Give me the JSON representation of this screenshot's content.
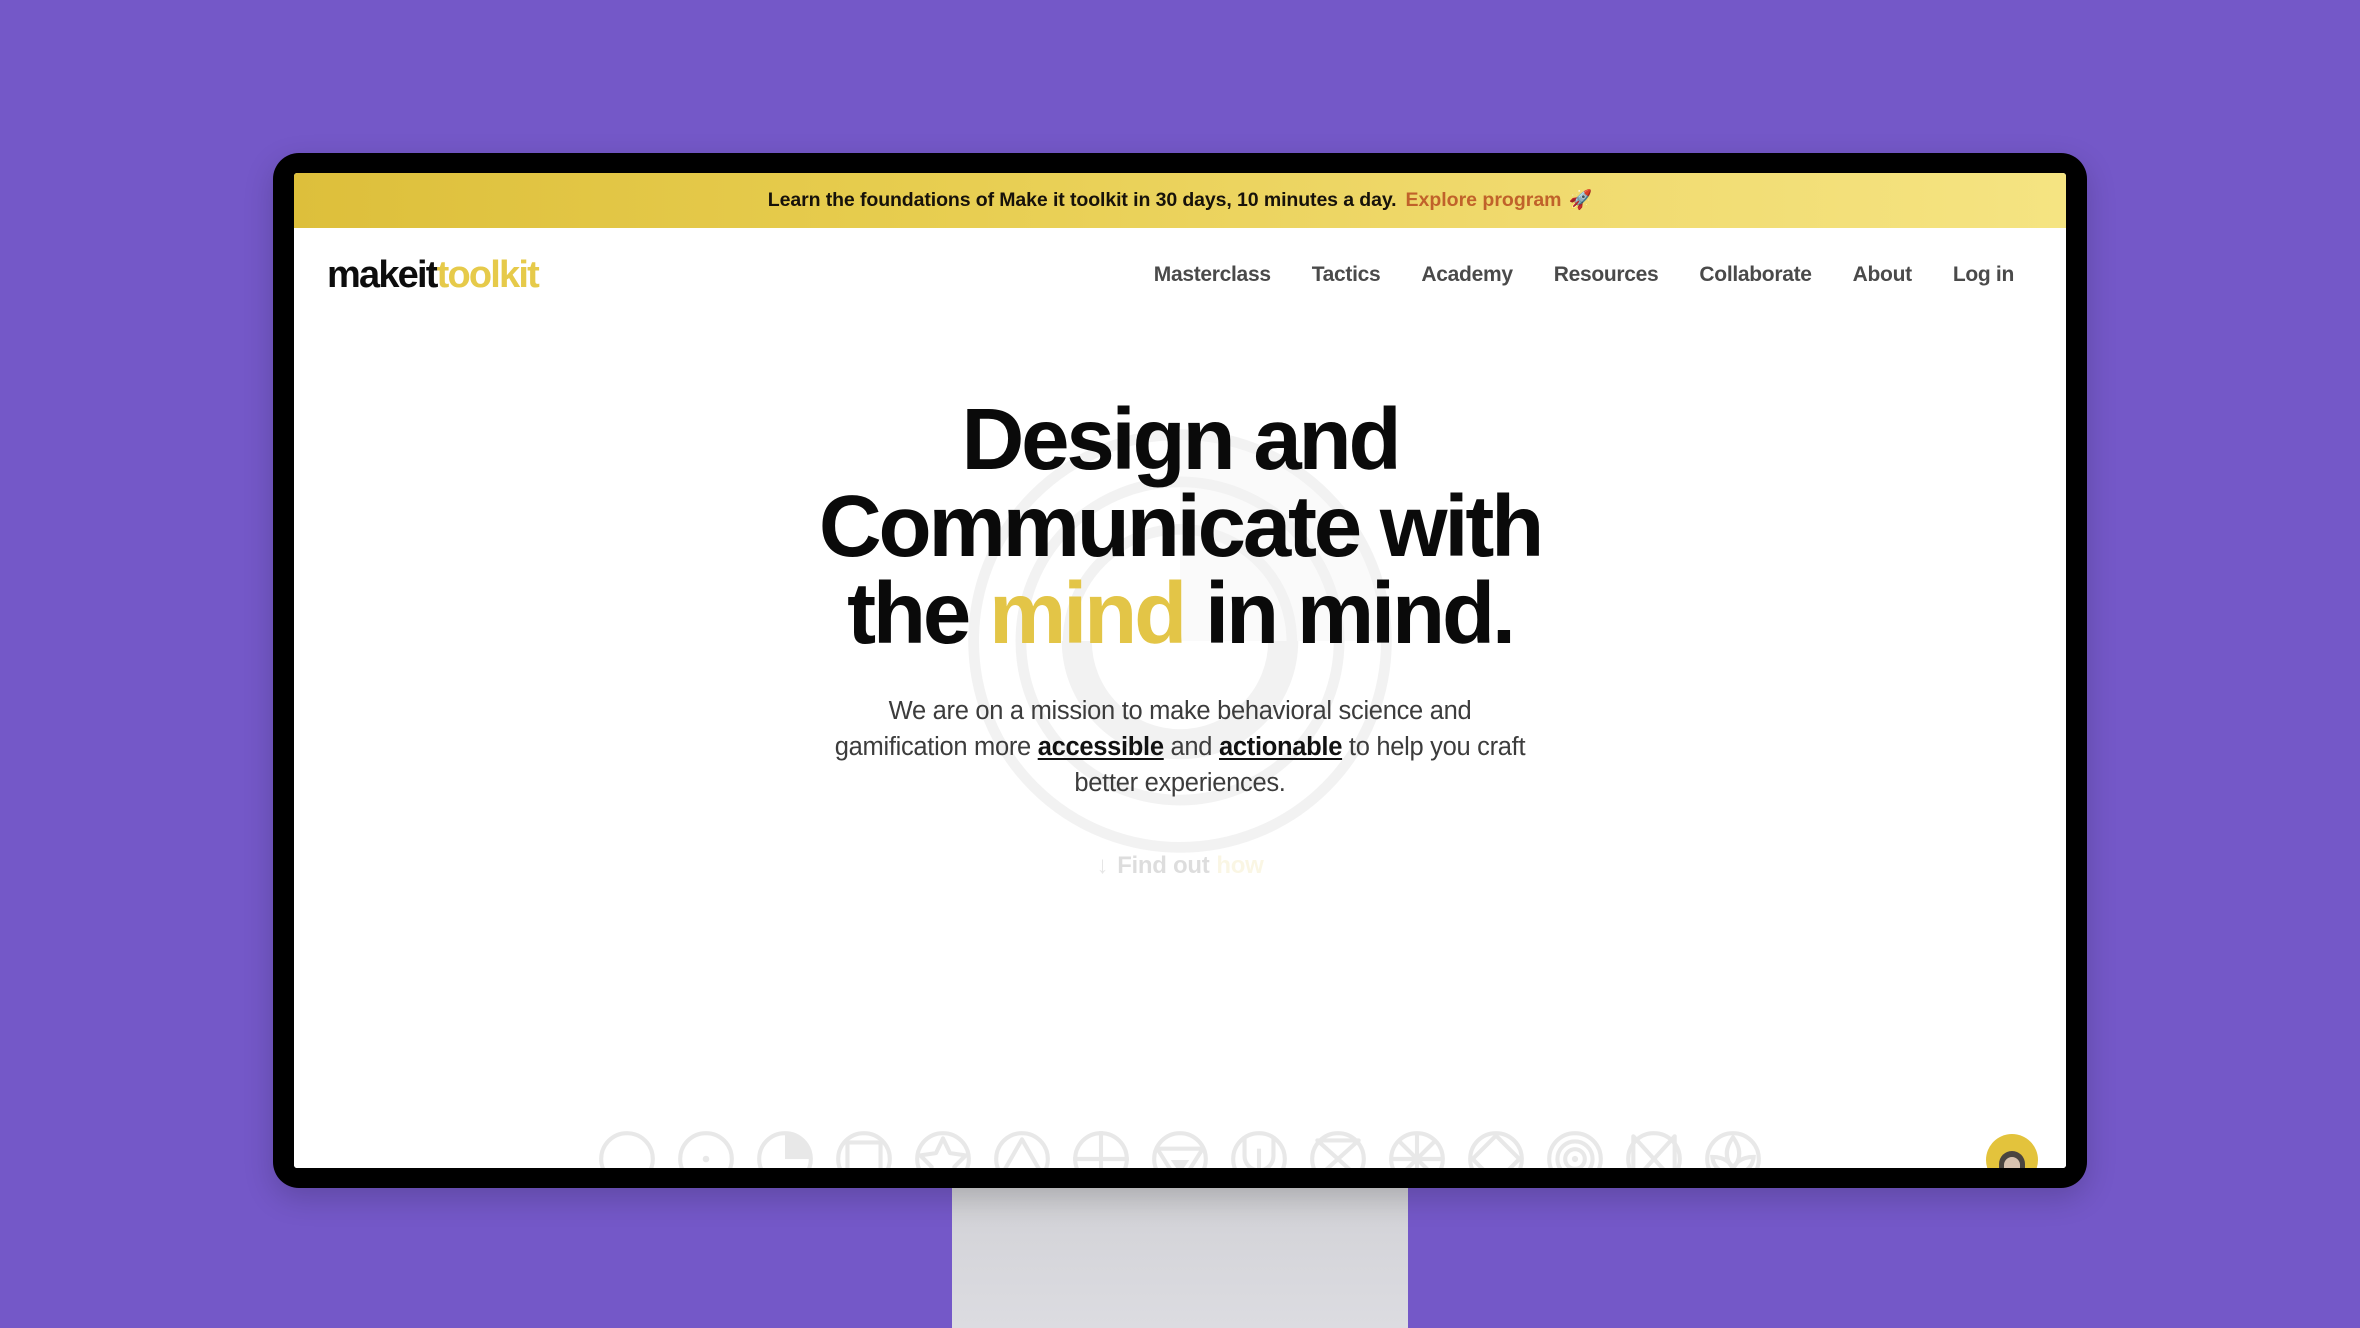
{
  "page": {
    "background_color": "#7458C8",
    "device": "desktop-monitor-mockup"
  },
  "promo_banner": {
    "text": "Learn the foundations of Make it toolkit in 30 days, 10 minutes a day.",
    "link_label": "Explore program",
    "emoji": "🚀",
    "bg_gradient_from": "#ddbf3b",
    "bg_gradient_to": "#f5e482",
    "link_color": "#c0622a"
  },
  "header": {
    "logo": {
      "part1": "makeit",
      "part2": "toolkit",
      "color1": "#0d0d0d",
      "color2": "#e6ca4a"
    },
    "nav": [
      {
        "label": "Masterclass"
      },
      {
        "label": "Tactics"
      },
      {
        "label": "Academy"
      },
      {
        "label": "Resources"
      },
      {
        "label": "Collaborate"
      },
      {
        "label": "About"
      },
      {
        "label": "Log in"
      }
    ]
  },
  "hero": {
    "title": {
      "line1": "Design and",
      "line2": "Communicate with",
      "line3_pre": "the",
      "line3_accent": "mind",
      "line3_post": "in mind.",
      "accent_color": "#e3c547"
    },
    "subtitle": {
      "part1": "We are on a mission to make behavioral science and gamification more",
      "link1": "accessible",
      "part2": "and",
      "link2": "actionable",
      "part3": "to help you craft better experiences."
    },
    "cta": {
      "arrow": "↓",
      "label": "Find out",
      "accent": "how"
    },
    "icons": [
      {
        "name": "circle-icon"
      },
      {
        "name": "circle-dot-icon"
      },
      {
        "name": "pie-chart-icon"
      },
      {
        "name": "square-in-circle-icon"
      },
      {
        "name": "star-in-circle-icon"
      },
      {
        "name": "triangle-in-circle-icon"
      },
      {
        "name": "crosshair-icon"
      },
      {
        "name": "inverted-triangle-icon"
      },
      {
        "name": "trident-icon"
      },
      {
        "name": "hourglass-icon"
      },
      {
        "name": "asterisk-icon"
      },
      {
        "name": "diamond-in-circle-icon"
      },
      {
        "name": "target-rings-icon"
      },
      {
        "name": "bowtie-icon"
      },
      {
        "name": "lotus-icon"
      }
    ]
  },
  "chat_widget": {
    "name": "chat-avatar-button"
  }
}
